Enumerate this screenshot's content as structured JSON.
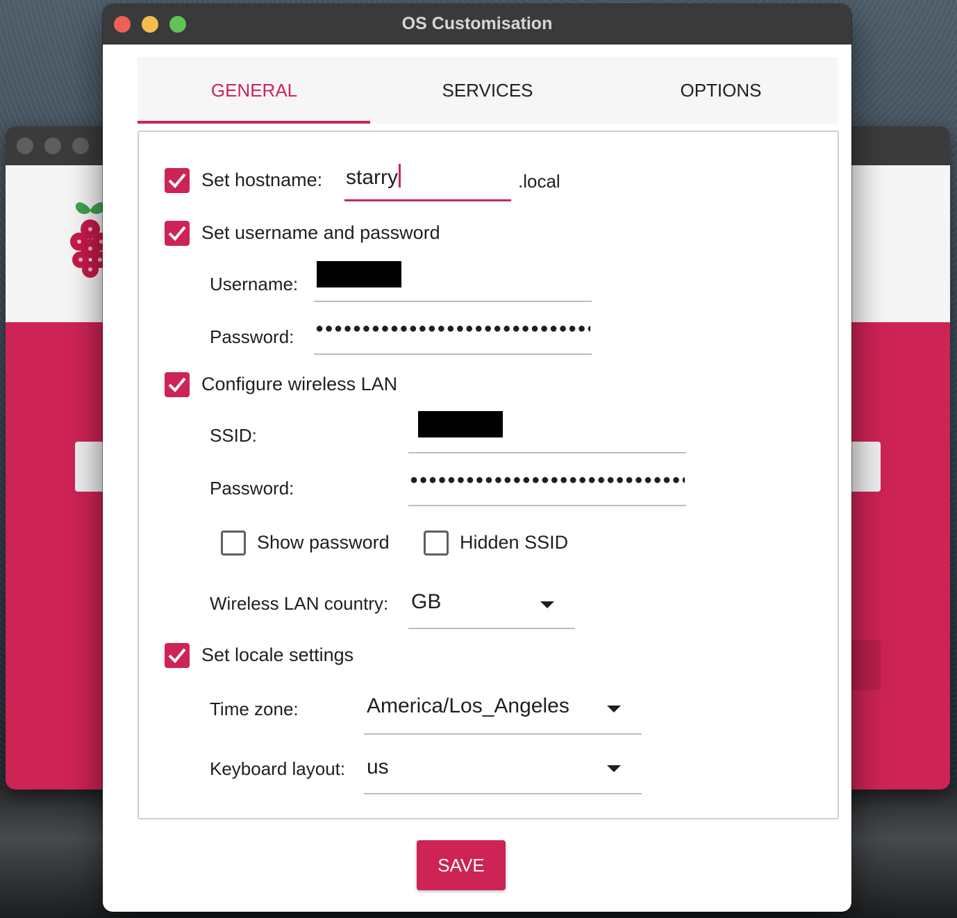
{
  "window": {
    "title": "OS Customisation"
  },
  "tabs": [
    {
      "label": "GENERAL",
      "active": true
    },
    {
      "label": "SERVICES",
      "active": false
    },
    {
      "label": "OPTIONS",
      "active": false
    }
  ],
  "general": {
    "hostname": {
      "checked": true,
      "label": "Set hostname:",
      "value": "starry",
      "suffix": ".local"
    },
    "user": {
      "checked": true,
      "label": "Set username and password",
      "username_label": "Username:",
      "password_label": "Password:",
      "password_mask": "●●●●●●●●●●●●●●●●●●●●●●●●●●●●●●●●●●●●"
    },
    "wifi": {
      "checked": true,
      "label": "Configure wireless LAN",
      "ssid_label": "SSID:",
      "password_label": "Password:",
      "password_mask": "●●●●●●●●●●●●●●●●●●●●●●●●●●●●●●●●●●●●●",
      "show_password_label": "Show password",
      "show_password_checked": false,
      "hidden_ssid_label": "Hidden SSID",
      "hidden_ssid_checked": false,
      "country_label": "Wireless LAN country:",
      "country_value": "GB"
    },
    "locale": {
      "checked": true,
      "label": "Set locale settings",
      "timezone_label": "Time zone:",
      "timezone_value": "America/Los_Angeles",
      "keyboard_label": "Keyboard layout:",
      "keyboard_value": "us"
    }
  },
  "save_label": "SAVE",
  "colors": {
    "accent": "#cd2355",
    "titlebar": "#3a3a3a",
    "traffic_close": "#ee5f57",
    "traffic_min": "#f4bd4f",
    "traffic_max": "#5fc454"
  }
}
